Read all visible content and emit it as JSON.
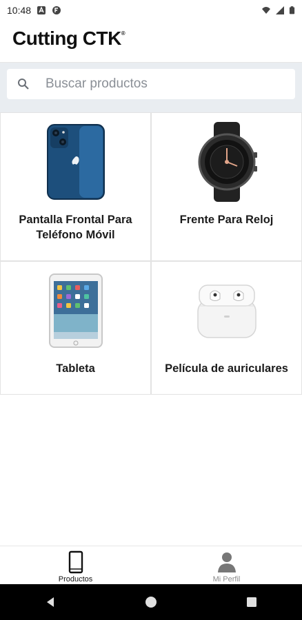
{
  "status_bar": {
    "time": "10:48"
  },
  "header": {
    "brand": "Cutting CTK",
    "brand_mark": "®"
  },
  "search": {
    "placeholder": "Buscar productos"
  },
  "products": [
    {
      "label": "Pantalla Frontal Para Teléfono Móvil",
      "icon": "smartphone"
    },
    {
      "label": "Frente Para Reloj",
      "icon": "smartwatch"
    },
    {
      "label": "Tableta",
      "icon": "tablet"
    },
    {
      "label": "Película de auriculares",
      "icon": "earbuds-case"
    }
  ],
  "bottom_nav": {
    "items": [
      {
        "label": "Productos",
        "icon": "phone-outline-icon",
        "active": true
      },
      {
        "label": "Mi Perfil",
        "icon": "person-icon",
        "active": false
      }
    ]
  },
  "colors": {
    "search_bg": "#e9edf1",
    "phone_blue": "#1d4f7c",
    "accent_dark": "#111111"
  }
}
